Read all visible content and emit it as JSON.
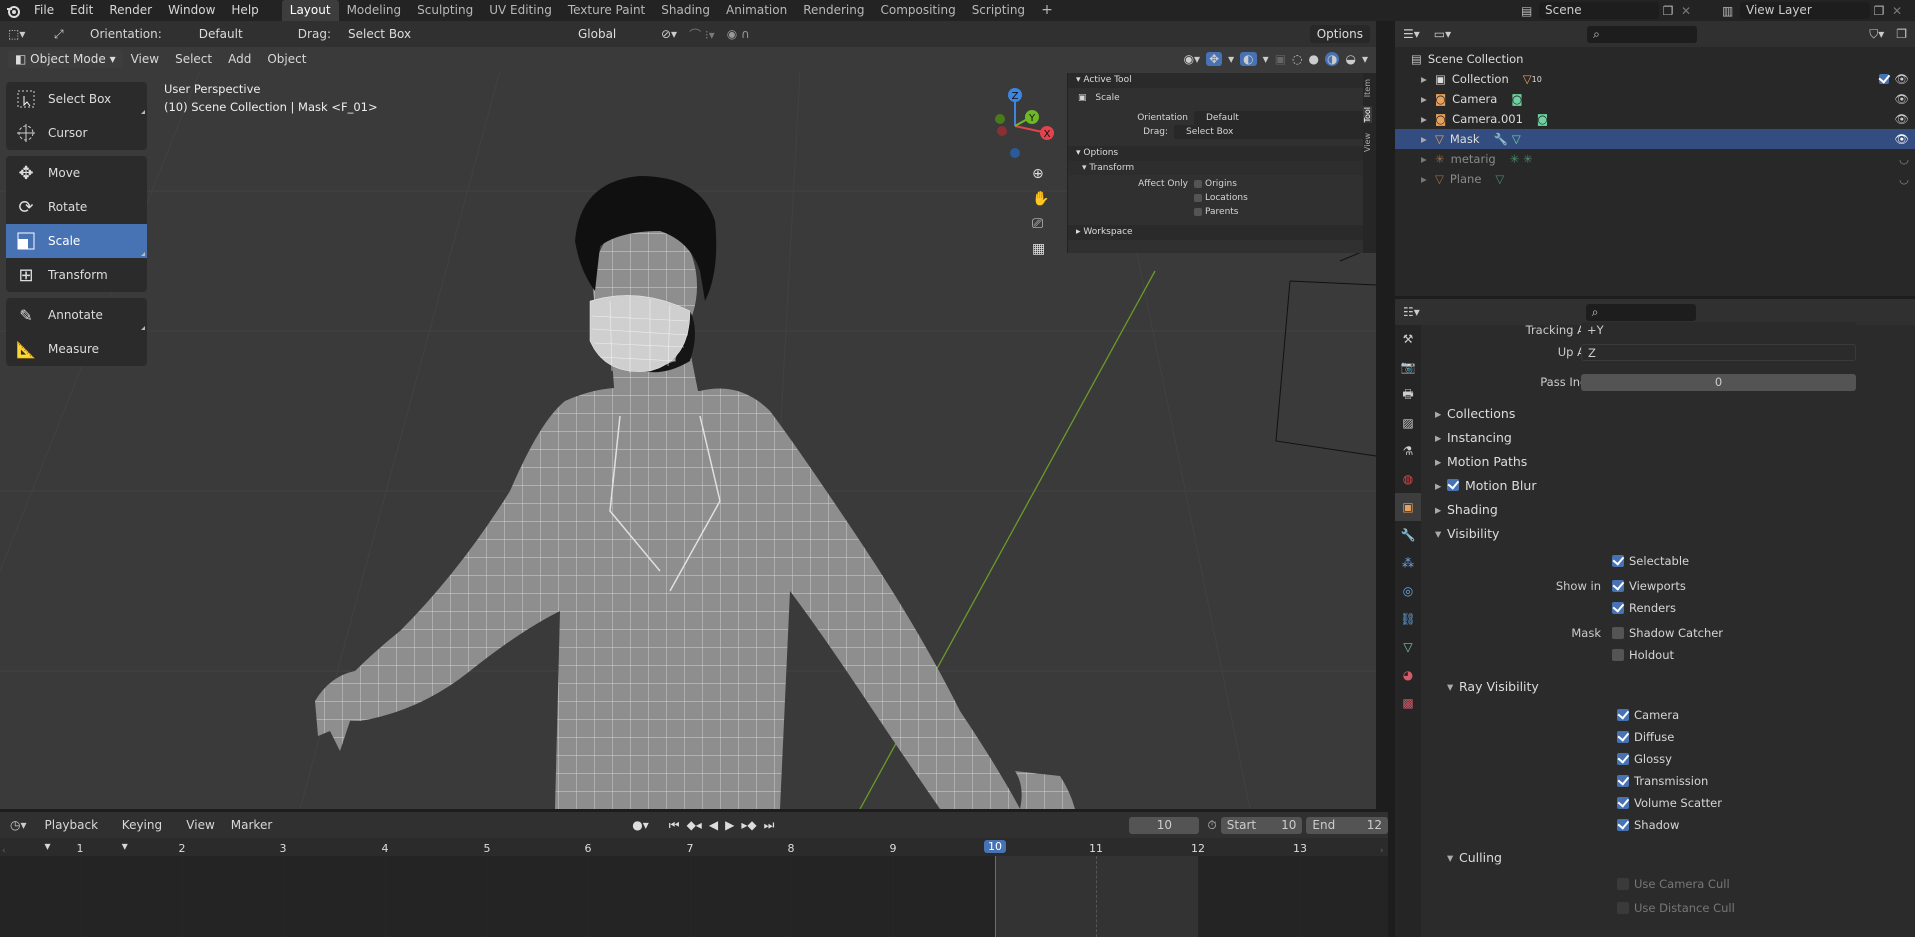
{
  "topbar": {
    "menus": [
      "File",
      "Edit",
      "Render",
      "Window",
      "Help"
    ],
    "workspaces": [
      "Layout",
      "Modeling",
      "Sculpting",
      "UV Editing",
      "Texture Paint",
      "Shading",
      "Animation",
      "Rendering",
      "Compositing",
      "Scripting"
    ],
    "active_workspace": "Layout",
    "add_tab": "+",
    "scene": "Scene",
    "view_layer": "View Layer"
  },
  "viewport": {
    "orientation_label": "Orientation:",
    "orientation_value": "Default",
    "drag_label": "Drag:",
    "drag_value": "Select Box",
    "transform_space": "Global",
    "options": "Options",
    "mode": "Object Mode",
    "menus": [
      "View",
      "Select",
      "Add",
      "Object"
    ],
    "overlay_title": "User Perspective",
    "overlay_subtitle": "(10) Scene Collection | Mask <F_01>",
    "gizmo": {
      "x": "X",
      "y": "Y",
      "z": "Z"
    }
  },
  "tools": [
    {
      "label": "Select Box",
      "icon": "select-box-icon",
      "active": false
    },
    {
      "label": "Cursor",
      "icon": "cursor-icon",
      "active": false
    },
    {
      "label": "Move",
      "icon": "move-icon",
      "active": false
    },
    {
      "label": "Rotate",
      "icon": "rotate-icon",
      "active": false
    },
    {
      "label": "Scale",
      "icon": "scale-icon",
      "active": true
    },
    {
      "label": "Transform",
      "icon": "transform-icon",
      "active": false
    },
    {
      "label": "Annotate",
      "icon": "annotate-icon",
      "active": false
    },
    {
      "label": "Measure",
      "icon": "measure-icon",
      "active": false
    }
  ],
  "npanel": {
    "active_tool": "Active Tool",
    "tool_name": "Scale",
    "orientation_label": "Orientation",
    "orientation_value": "Default",
    "drag_label": "Drag:",
    "drag_value": "Select Box",
    "options": "Options",
    "transform": "Transform",
    "affect_only": "Affect Only",
    "origins": "Origins",
    "locations": "Locations",
    "parents": "Parents",
    "workspace": "Workspace",
    "tabs": [
      "Item",
      "Tool",
      "View"
    ]
  },
  "outliner": {
    "root": "Scene Collection",
    "items": [
      {
        "label": "Collection",
        "badge": "10",
        "selected": false,
        "dim": false
      },
      {
        "label": "Camera",
        "selected": false,
        "dim": false
      },
      {
        "label": "Camera.001",
        "selected": false,
        "dim": false
      },
      {
        "label": "Mask",
        "selected": true,
        "dim": false
      },
      {
        "label": "metarig",
        "selected": false,
        "dim": true
      },
      {
        "label": "Plane",
        "selected": false,
        "dim": true
      }
    ]
  },
  "properties": {
    "tracking_axis_label": "Tracking Axis",
    "tracking_axis_value": "+Y",
    "up_axis_label": "Up Axis",
    "up_axis_value": "Z",
    "pass_index_label": "Pass Index",
    "pass_index_value": "0",
    "panels": [
      "Collections",
      "Instancing",
      "Motion Paths",
      "Motion Blur",
      "Shading"
    ],
    "visibility": "Visibility",
    "selectable": "Selectable",
    "show_in": "Show in",
    "viewports": "Viewports",
    "renders": "Renders",
    "mask": "Mask",
    "shadow_catcher": "Shadow Catcher",
    "holdout": "Holdout",
    "ray_visibility": "Ray Visibility",
    "rays": [
      "Camera",
      "Diffuse",
      "Glossy",
      "Transmission",
      "Volume Scatter",
      "Shadow"
    ],
    "culling": "Culling",
    "use_camera_cull": "Use Camera Cull",
    "use_distance_cull": "Use Distance Cull"
  },
  "timeline": {
    "menus": [
      "Playback",
      "Keying",
      "View",
      "Marker"
    ],
    "current_frame": "10",
    "start_label": "Start",
    "start_value": "10",
    "end_label": "End",
    "end_value": "12",
    "frames": [
      "1",
      "2",
      "3",
      "4",
      "5",
      "6",
      "7",
      "8",
      "9",
      "10",
      "11",
      "12",
      "13"
    ]
  },
  "colors": {
    "accent": "#4772b3",
    "selection": "#334d80",
    "axis_x": "#e2444d",
    "axis_y": "#6fb825",
    "axis_z": "#3d85e0"
  }
}
